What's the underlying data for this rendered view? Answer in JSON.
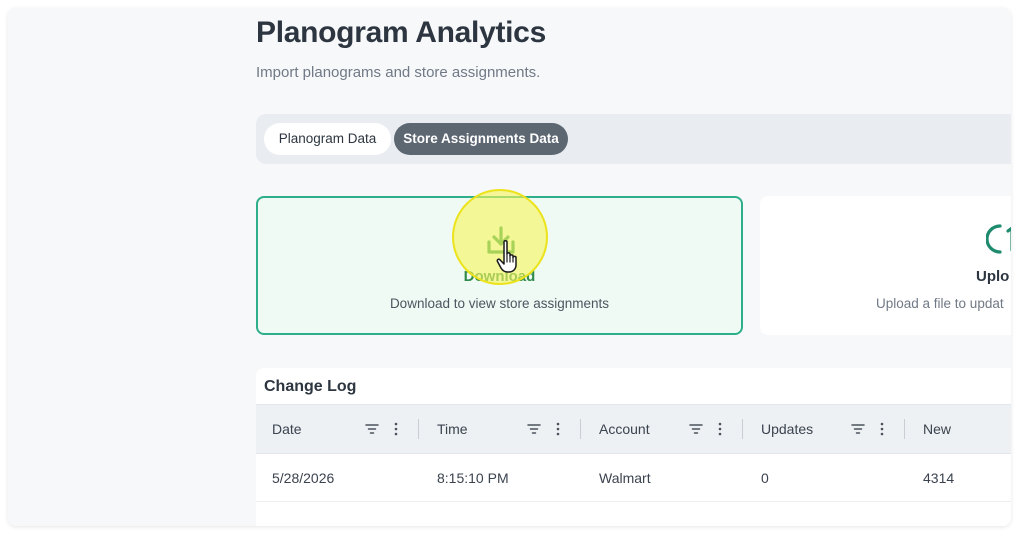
{
  "page": {
    "title": "Planogram Analytics",
    "subtitle": "Import planograms and store assignments."
  },
  "tabs": [
    {
      "label": "Planogram Data",
      "active": false
    },
    {
      "label": "Store Assignments Data",
      "active": true
    }
  ],
  "cards": {
    "download": {
      "title": "Download",
      "description": "Download to view store assignments",
      "icon": "download-icon"
    },
    "upload": {
      "title": "Uplo",
      "description": "Upload a file to updat",
      "icon": "upload-icon"
    }
  },
  "change_log": {
    "title": "Change Log",
    "columns": [
      "Date",
      "Time",
      "Account",
      "Updates",
      "New"
    ],
    "rows": [
      {
        "date": "5/28/2026",
        "time": "8:15:10 PM",
        "account": "Walmart",
        "updates": "0",
        "new": "4314"
      }
    ]
  },
  "colors": {
    "accent_green": "#2eae8a",
    "download_text": "#2f8a4a",
    "active_tab": "#5d6772",
    "highlight": "#f5f55a"
  }
}
